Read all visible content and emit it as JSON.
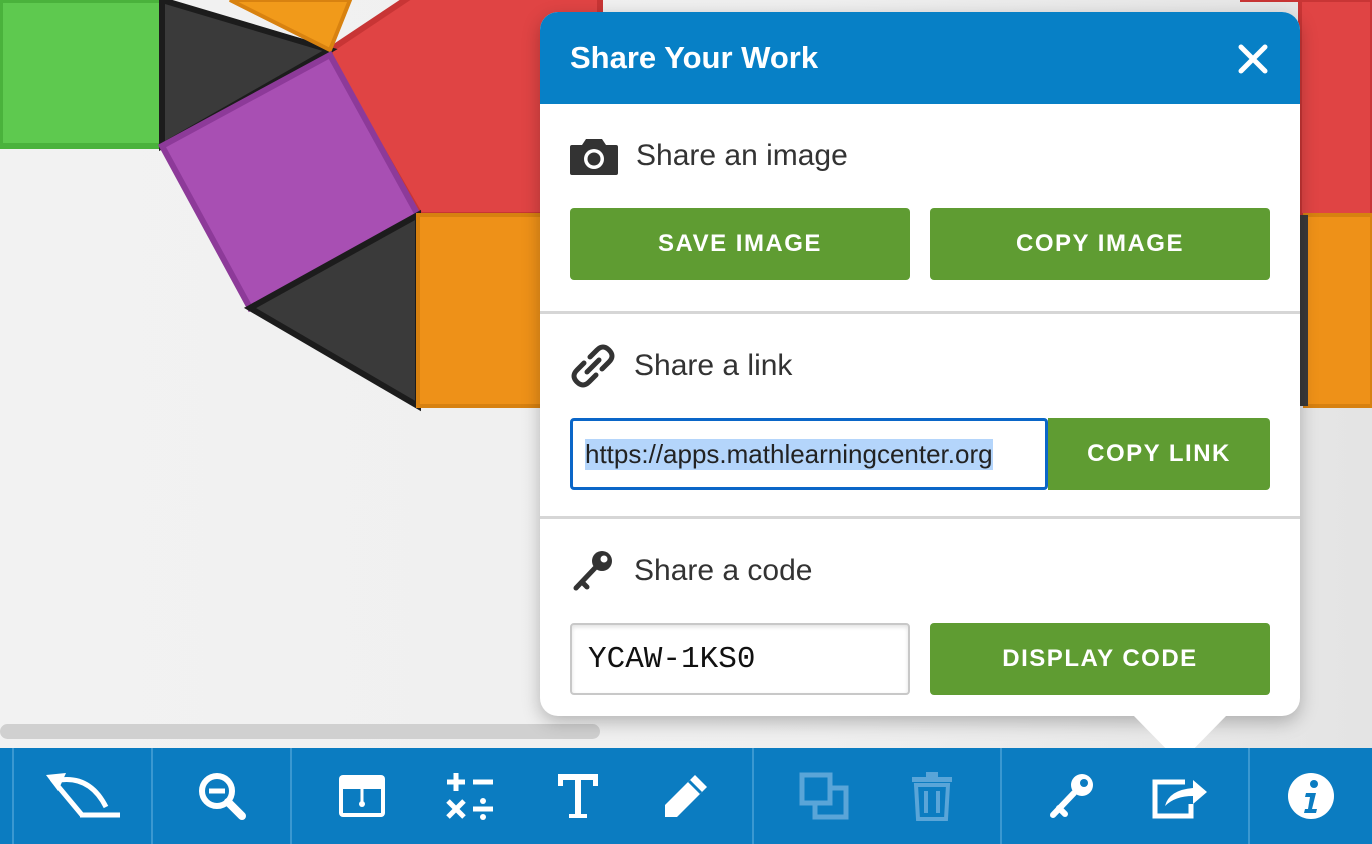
{
  "dialog": {
    "title": "Share Your Work",
    "image_section": {
      "label": "Share an image",
      "save_button": "SAVE IMAGE",
      "copy_button": "COPY IMAGE"
    },
    "link_section": {
      "label": "Share a link",
      "url": "https://apps.mathlearningcenter.org",
      "copy_button": "COPY LINK"
    },
    "code_section": {
      "label": "Share a code",
      "code": "YCAW-1KS0",
      "display_button": "DISPLAY CODE"
    }
  },
  "toolbar": {
    "items": [
      {
        "icon": "undo-icon"
      },
      {
        "icon": "zoom-out-icon"
      },
      {
        "icon": "screen-cover-icon"
      },
      {
        "icon": "math-operations-icon"
      },
      {
        "icon": "text-tool-icon"
      },
      {
        "icon": "pencil-icon"
      },
      {
        "icon": "duplicate-icon",
        "enabled": false
      },
      {
        "icon": "trash-icon",
        "enabled": false
      },
      {
        "icon": "key-icon"
      },
      {
        "icon": "share-icon"
      },
      {
        "icon": "info-icon"
      }
    ]
  },
  "colors": {
    "toolbar": "#0b7cc1",
    "header": "#0780c6",
    "button_green": "#5f9c32",
    "piece_green": "#5ec94f",
    "piece_red": "#e04444",
    "piece_orange": "#ee9118",
    "piece_purple": "#a84fb3",
    "piece_black": "#333333"
  }
}
